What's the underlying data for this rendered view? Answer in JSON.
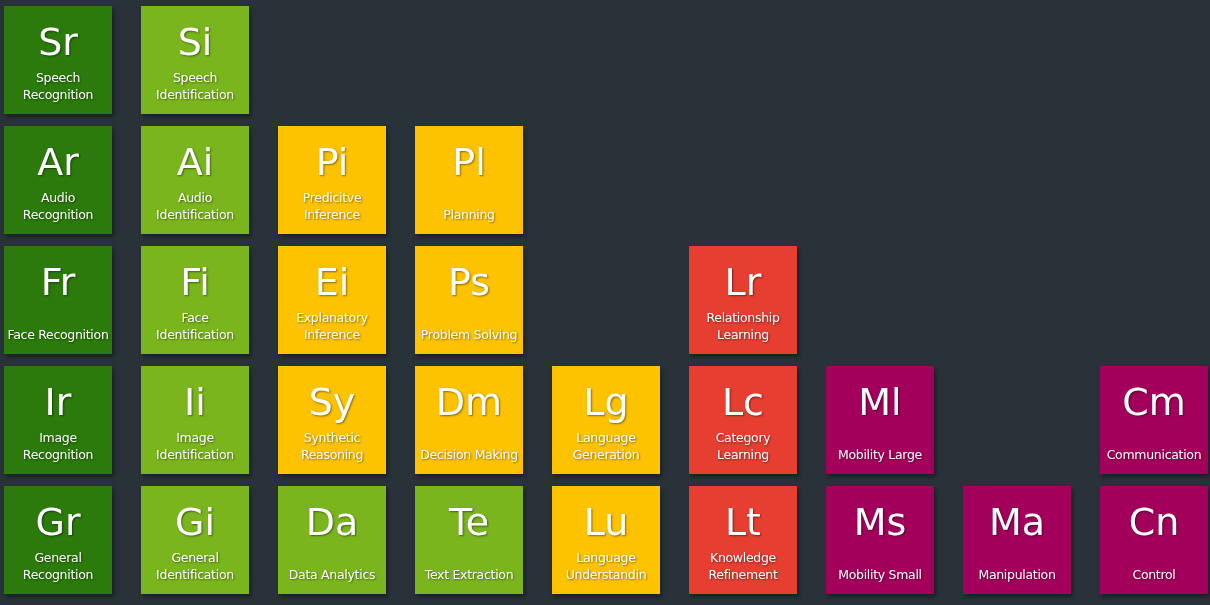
{
  "rows": [
    {
      "cells": [
        {
          "kind": "tile",
          "symbol": "Sr",
          "name": "Speech Recognition",
          "color": "#2b7a0b"
        },
        {
          "kind": "tile",
          "symbol": "Si",
          "name": "Speech Identification",
          "color": "#7ab51d"
        },
        {
          "kind": "empty"
        },
        {
          "kind": "empty"
        },
        {
          "kind": "empty"
        },
        {
          "kind": "empty"
        },
        {
          "kind": "empty"
        },
        {
          "kind": "empty"
        },
        {
          "kind": "empty"
        }
      ]
    },
    {
      "cells": [
        {
          "kind": "tile",
          "symbol": "Ar",
          "name": "Audio Recognition",
          "color": "#2b7a0b"
        },
        {
          "kind": "tile",
          "symbol": "Ai",
          "name": "Audio Identification",
          "color": "#7ab51d"
        },
        {
          "kind": "tile",
          "symbol": "Pi",
          "name": "Predicitve Inference",
          "color": "#fdc200"
        },
        {
          "kind": "tile",
          "symbol": "Pl",
          "name": "Planning",
          "color": "#fdc200"
        },
        {
          "kind": "empty"
        },
        {
          "kind": "empty"
        },
        {
          "kind": "empty"
        },
        {
          "kind": "empty"
        },
        {
          "kind": "empty"
        }
      ]
    },
    {
      "cells": [
        {
          "kind": "tile",
          "symbol": "Fr",
          "name": "Face Recognition",
          "color": "#2b7a0b"
        },
        {
          "kind": "tile",
          "symbol": "Fi",
          "name": "Face Identification",
          "color": "#7ab51d"
        },
        {
          "kind": "tile",
          "symbol": "Ei",
          "name": "Explanatory Inference",
          "color": "#fdc200"
        },
        {
          "kind": "tile",
          "symbol": "Ps",
          "name": "Problem Solving",
          "color": "#fdc200"
        },
        {
          "kind": "empty"
        },
        {
          "kind": "tile",
          "symbol": "Lr",
          "name": "Relationship Learning",
          "color": "#e63e31"
        },
        {
          "kind": "empty"
        },
        {
          "kind": "empty"
        },
        {
          "kind": "empty"
        }
      ]
    },
    {
      "cells": [
        {
          "kind": "tile",
          "symbol": "Ir",
          "name": "Image Recognition",
          "color": "#2b7a0b"
        },
        {
          "kind": "tile",
          "symbol": "Ii",
          "name": "Image Identification",
          "color": "#7ab51d"
        },
        {
          "kind": "tile",
          "symbol": "Sy",
          "name": "Synthetic Reasoning",
          "color": "#fdc200"
        },
        {
          "kind": "tile",
          "symbol": "Dm",
          "name": "Decision Making",
          "color": "#fdc200"
        },
        {
          "kind": "tile",
          "symbol": "Lg",
          "name": "Language Generation",
          "color": "#fdc200"
        },
        {
          "kind": "tile",
          "symbol": "Lc",
          "name": "Category Learning",
          "color": "#e63e31"
        },
        {
          "kind": "tile",
          "symbol": "Ml",
          "name": "Mobility Large",
          "color": "#a3005b"
        },
        {
          "kind": "empty"
        },
        {
          "kind": "tile",
          "symbol": "Cm",
          "name": "Communication",
          "color": "#a3005b"
        }
      ]
    },
    {
      "cells": [
        {
          "kind": "tile",
          "symbol": "Gr",
          "name": "General Recognition",
          "color": "#2b7a0b"
        },
        {
          "kind": "tile",
          "symbol": "Gi",
          "name": "General Identification",
          "color": "#7ab51d"
        },
        {
          "kind": "tile",
          "symbol": "Da",
          "name": "Data Analytics",
          "color": "#7ab51d"
        },
        {
          "kind": "tile",
          "symbol": "Te",
          "name": "Text Extraction",
          "color": "#7ab51d"
        },
        {
          "kind": "tile",
          "symbol": "Lu",
          "name": "Language Understandin",
          "color": "#fdc200"
        },
        {
          "kind": "tile",
          "symbol": "Lt",
          "name": "Knowledge Refinement",
          "color": "#e63e31"
        },
        {
          "kind": "tile",
          "symbol": "Ms",
          "name": "Mobility Small",
          "color": "#a3005b"
        },
        {
          "kind": "tile",
          "symbol": "Ma",
          "name": "Manipulation",
          "color": "#a3005b"
        },
        {
          "kind": "tile",
          "symbol": "Cn",
          "name": "Control",
          "color": "#a3005b"
        }
      ]
    }
  ]
}
